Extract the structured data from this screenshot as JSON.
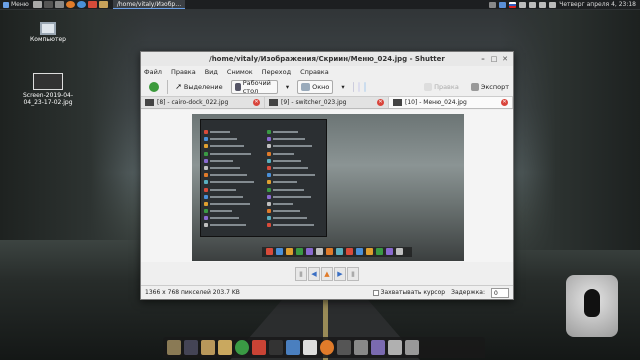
{
  "top_panel": {
    "menu_label": "Меню",
    "task_label": "/home/vitaly/Изобр…",
    "datetime": "Четверг апреля 4, 23:18"
  },
  "desktop": {
    "icons": [
      {
        "label": "Компьютер",
        "icon": "computer-icon"
      },
      {
        "label": "Screen-2019-04-04_23-17-02.jpg",
        "icon": "image-file-icon"
      }
    ]
  },
  "window": {
    "title": "/home/vitaly/Изображения/Скриин/Меню_024.jpg - Shutter",
    "menu": [
      "Файл",
      "Правка",
      "Вид",
      "Снимок",
      "Переход",
      "Справка"
    ],
    "toolbar": {
      "selection": "Выделение",
      "desktop": "Рабочий стол",
      "window": "Окно",
      "edit": "Правка",
      "export": "Экспорт"
    },
    "tabs": [
      {
        "label": "[8] - cairo-dock_022.jpg"
      },
      {
        "label": "[9] - switcher_023.jpg"
      },
      {
        "label": "[10] - Меню_024.jpg"
      }
    ],
    "status": {
      "info": "1366 x 768 пикселей  203.7 KB",
      "capture_cursor": "Захватывать курсор",
      "delay_label": "Задержка:",
      "delay_value": "0"
    }
  },
  "colors": {
    "accent": "#3a6fc4",
    "close": "#d9443b",
    "panel": "#1d1f21"
  }
}
